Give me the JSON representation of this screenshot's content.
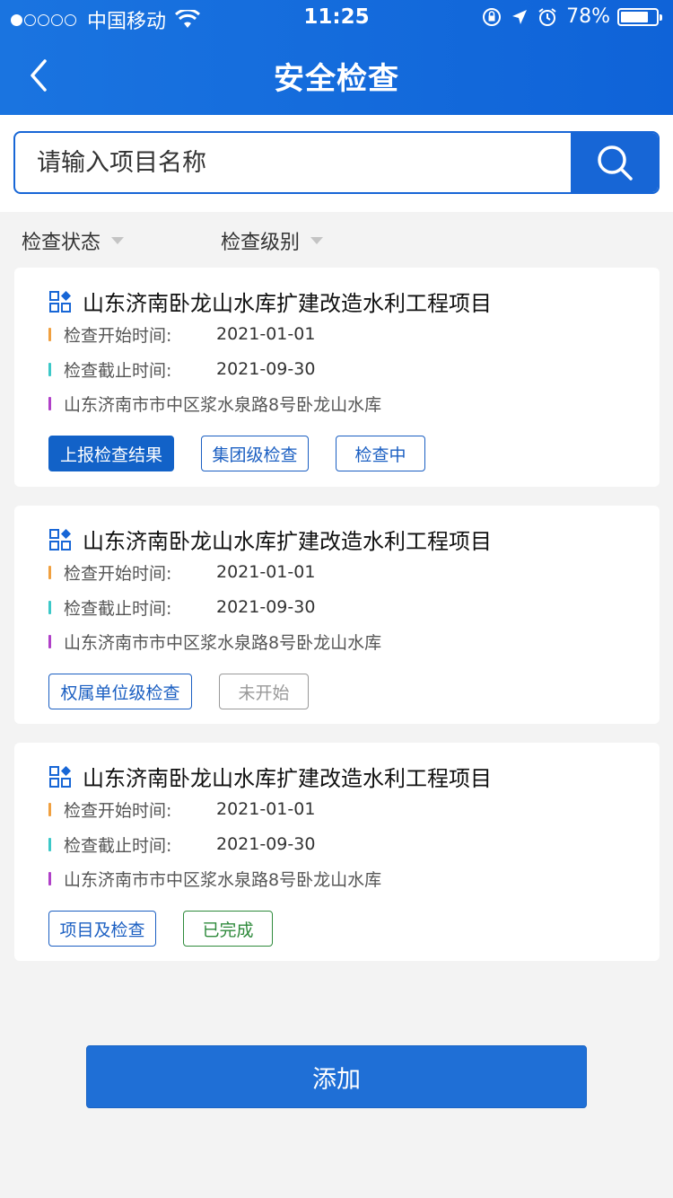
{
  "status_bar": {
    "carrier": "中国移动",
    "time": "11:25",
    "battery_percent": "78%",
    "battery_level": 0.78
  },
  "header": {
    "title": "安全检查",
    "back_icon": "chevron-left-icon"
  },
  "search": {
    "placeholder": "请输入项目名称",
    "button_icon": "search-icon"
  },
  "filters": [
    {
      "label": "检查状态"
    },
    {
      "label": "检查级别"
    }
  ],
  "cards": [
    {
      "title": "山东济南卧龙山水库扩建改造水利工程项目",
      "start_label": "检查开始时间:",
      "start_value": "2021-01-01",
      "end_label": "检查截止时间:",
      "end_value": "2021-09-30",
      "address": "山东济南市市中区浆水泉路8号卧龙山水库",
      "tags": [
        "上报检查结果",
        "集团级检查",
        "检查中"
      ]
    },
    {
      "title": "山东济南卧龙山水库扩建改造水利工程项目",
      "start_label": "检查开始时间:",
      "start_value": "2021-01-01",
      "end_label": "检查截止时间:",
      "end_value": "2021-09-30",
      "address": "山东济南市市中区浆水泉路8号卧龙山水库",
      "tags": [
        "权属单位级检查",
        "未开始"
      ]
    },
    {
      "title": "山东济南卧龙山水库扩建改造水利工程项目",
      "start_label": "检查开始时间:",
      "start_value": "2021-01-01",
      "end_label": "检查截止时间:",
      "end_value": "2021-09-30",
      "address": "山东济南市市中区浆水泉路8号卧龙山水库",
      "tags": [
        "项目及检查",
        "已完成"
      ]
    }
  ],
  "add_button": {
    "label": "添加"
  },
  "colors": {
    "primary": "#1766d6",
    "bar_start": "#f0a040",
    "bar_end": "#3cc8c8",
    "bar_address": "#b040c8",
    "status_gray": "#999999",
    "status_green": "#2e8a3b"
  }
}
